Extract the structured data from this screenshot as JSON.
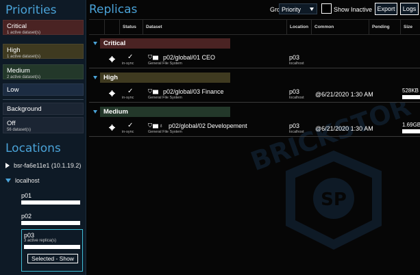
{
  "sidebar": {
    "priorities_title": "Priorities",
    "priorities": [
      {
        "name": "Critical",
        "sub": "1 active dataset(s)",
        "color": "#4a2323"
      },
      {
        "name": "High",
        "sub": "1 active dataset(s)",
        "color": "#3f3a20"
      },
      {
        "name": "Medium",
        "sub": "2 active dataset(s)",
        "color": "#23382a"
      },
      {
        "name": "Low",
        "sub": "",
        "color": "#1c2c42"
      },
      {
        "name": "Background",
        "sub": "",
        "color": "#1b2533"
      },
      {
        "name": "Off",
        "sub": "56 dataset(s)",
        "color": "#1b2533"
      }
    ],
    "locations_title": "Locations",
    "locations": [
      {
        "name": "bsr-fa6e11e1 (10.1.19.2)",
        "expanded": false
      },
      {
        "name": "localhost",
        "expanded": true
      }
    ],
    "pools": [
      {
        "name": "p01"
      },
      {
        "name": "p02"
      }
    ],
    "selected_pool": {
      "name": "p03",
      "sub": "3 active replica(s)",
      "button": "Selected - Show"
    }
  },
  "main": {
    "title": "Replicas",
    "group_by_label": "Group by:",
    "group_by_value": "Priority",
    "show_inactive_label": "Show Inactive",
    "export_label": "Export",
    "logs_label": "Logs",
    "columns": [
      "Status",
      "Dataset",
      "Location",
      "Common",
      "Pending",
      "Size"
    ],
    "groups": [
      {
        "name": "Critical",
        "color": "#4a2323"
      },
      {
        "name": "High",
        "color": "#3f3a20"
      },
      {
        "name": "Medium",
        "color": "#23382a"
      }
    ],
    "rows": [
      {
        "status": "in-sync",
        "dataset": "p02/global/01 CEO",
        "type": "General File System",
        "location": "p03",
        "location_sub": "localhost",
        "common": "",
        "size": ""
      },
      {
        "status": "in-sync",
        "dataset": "p02/global/03 Finance",
        "type": "General File System",
        "location": "p03",
        "location_sub": "localhost",
        "common": "@6/21/2020 1:30 AM",
        "size": "528KB"
      },
      {
        "status": "in-sync",
        "dataset": "p02/global/02 Developement",
        "type": "General File System",
        "location": "p03",
        "location_sub": "localhost",
        "common": "@6/21/2020 1:30 AM",
        "size": "1.69GB"
      }
    ],
    "watermark": "BRICKSTOR SP"
  }
}
